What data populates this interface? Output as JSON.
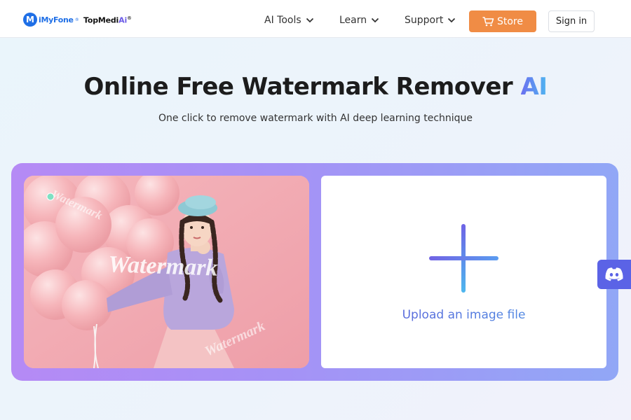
{
  "header": {
    "logo_imyfone": "iMyFone",
    "logo_imyfone_mark": "®",
    "logo_topmedi_prefix": "TopMedi",
    "logo_topmedi_ai": "Ai",
    "logo_topmedi_mark": "®",
    "nav": [
      {
        "label": "AI Tools"
      },
      {
        "label": "Learn"
      },
      {
        "label": "Support"
      }
    ],
    "store_label": "Store",
    "signin_label": "Sign in"
  },
  "hero": {
    "title_main": "Online Free Watermark Remover",
    "title_ai": "AI",
    "subtitle": "One click to remove watermark with AI deep learning technique"
  },
  "sample": {
    "watermark_texts": [
      "Watermark",
      "Watermark",
      "Watermark"
    ]
  },
  "upload": {
    "label": "Upload an image file"
  },
  "colors": {
    "accent_orange": "#f08c45",
    "panel_purple": "#b58af5",
    "panel_blue": "#91a7f6",
    "discord_blue": "#5b63e6",
    "brand_blue": "#1f6fe6"
  },
  "icons": [
    "imyfone-logo-icon",
    "chevron-down-icon",
    "cart-icon",
    "plus-icon",
    "discord-icon"
  ]
}
